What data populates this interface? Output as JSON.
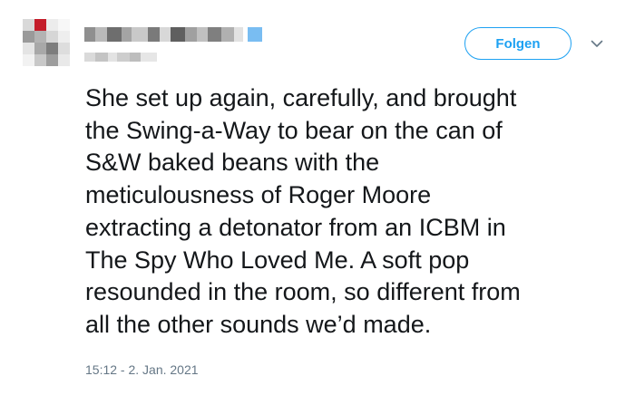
{
  "header": {
    "follow_label": "Folgen"
  },
  "icons": {
    "menu": "chevron-down-icon"
  },
  "colors": {
    "accent": "#1da1f2",
    "text": "#14171a",
    "muted": "#657786"
  },
  "tweet": {
    "text": "She set up again, carefully, and brought\nthe Swing-a-Way to bear on the can of\nS&W baked beans with the\nmeticulousness of Roger Moore\nextracting a detonator from an ICBM in\nThe Spy Who Loved Me. A soft pop\nresounded in the room, so different from\nall the other sounds we’d made.",
    "timestamp": "15:12 - 2. Jan. 2021"
  }
}
